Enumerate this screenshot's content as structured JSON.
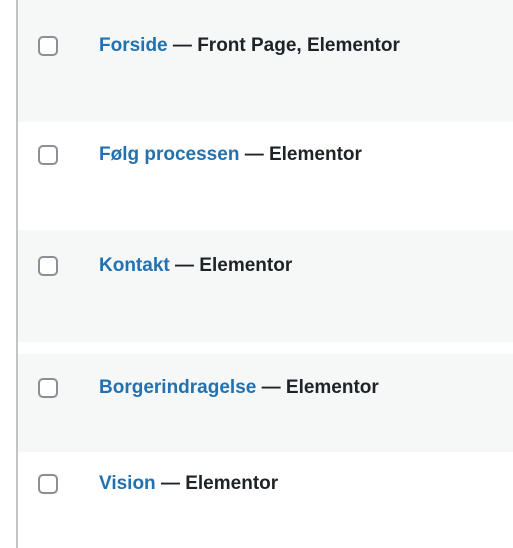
{
  "pages": [
    {
      "title": "Forside",
      "separator": "—",
      "states": "Front Page, Elementor"
    },
    {
      "title": "Følg processen",
      "separator": "—",
      "states": "Elementor"
    },
    {
      "title": "Kontakt",
      "separator": "—",
      "states": "Elementor"
    },
    {
      "title": "Borgerindragelse",
      "separator": "—",
      "states": "Elementor"
    },
    {
      "title": "Vision",
      "separator": "—",
      "states": "Elementor"
    }
  ],
  "colors": {
    "link": "#2271b1",
    "text": "#1d2327",
    "row_alt_bg": "#f6f7f7",
    "border": "#c3c4c7"
  }
}
